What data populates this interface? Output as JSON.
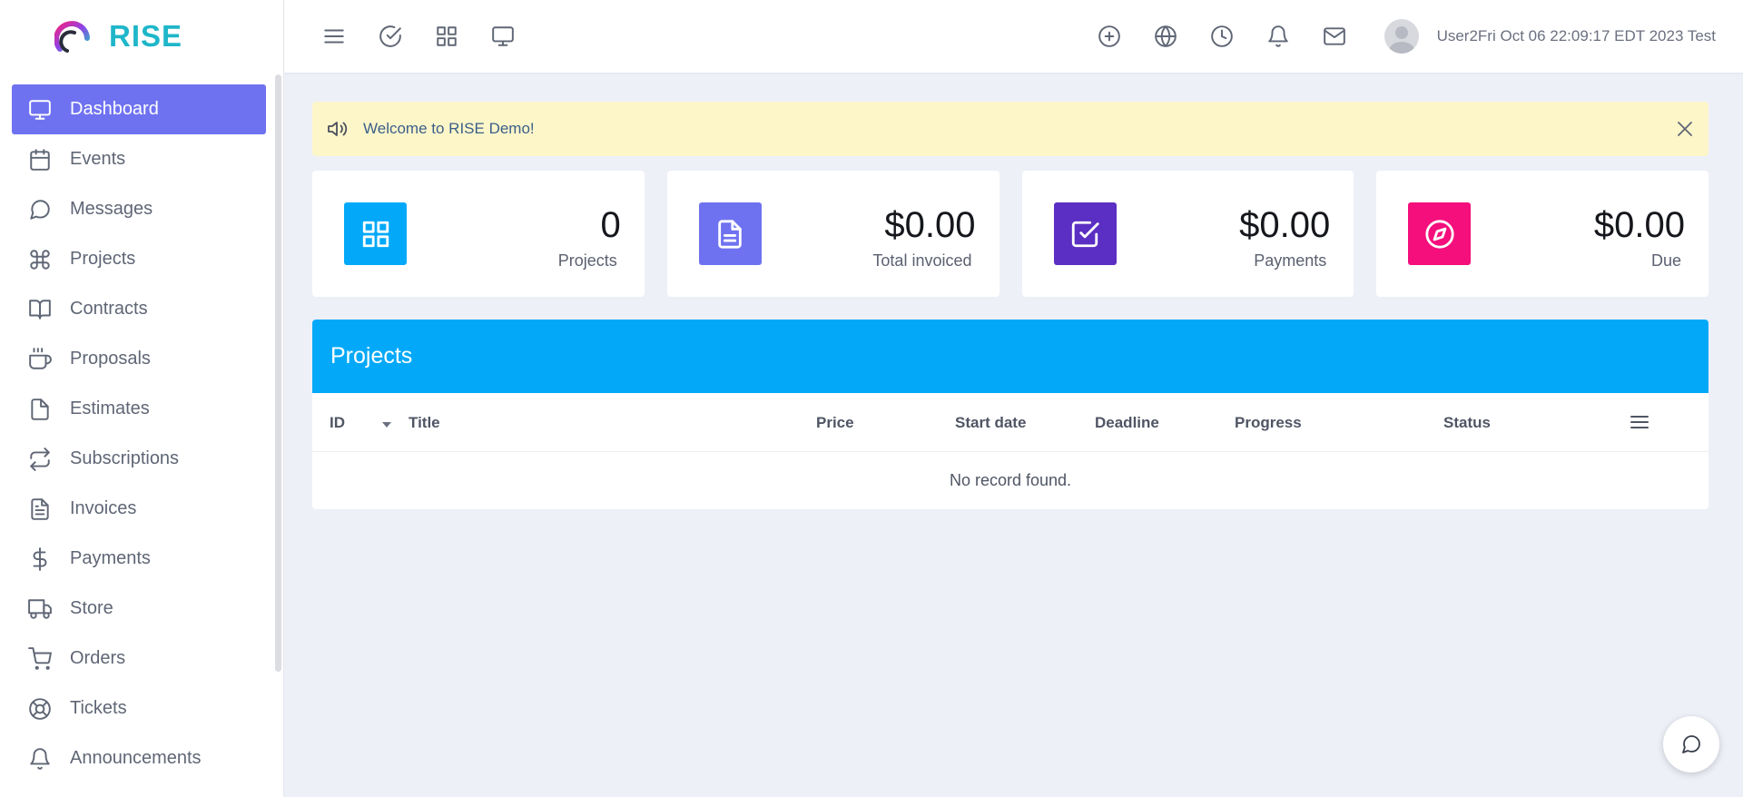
{
  "brand": {
    "name": "RISE"
  },
  "sidebar": {
    "items": [
      {
        "label": "Dashboard",
        "icon": "monitor-icon",
        "active": true
      },
      {
        "label": "Events",
        "icon": "calendar-icon"
      },
      {
        "label": "Messages",
        "icon": "message-circle-icon"
      },
      {
        "label": "Projects",
        "icon": "command-icon"
      },
      {
        "label": "Contracts",
        "icon": "book-open-icon"
      },
      {
        "label": "Proposals",
        "icon": "coffee-icon"
      },
      {
        "label": "Estimates",
        "icon": "file-icon"
      },
      {
        "label": "Subscriptions",
        "icon": "repeat-icon"
      },
      {
        "label": "Invoices",
        "icon": "file-text-icon"
      },
      {
        "label": "Payments",
        "icon": "dollar-sign-icon"
      },
      {
        "label": "Store",
        "icon": "truck-icon"
      },
      {
        "label": "Orders",
        "icon": "shopping-cart-icon"
      },
      {
        "label": "Tickets",
        "icon": "life-buoy-icon"
      },
      {
        "label": "Announcements",
        "icon": "bell-icon"
      }
    ]
  },
  "topbar": {
    "left_icons": [
      "menu-icon",
      "check-circle-icon",
      "grid-icon",
      "monitor-icon"
    ],
    "right_icons": [
      "plus-circle-icon",
      "globe-icon",
      "clock-icon",
      "bell-icon",
      "mail-icon"
    ],
    "user_name": "User2Fri Oct 06 22:09:17 EDT 2023 Test"
  },
  "alert": {
    "text": "Welcome to RISE Demo!"
  },
  "cards": [
    {
      "value": "0",
      "label": "Projects",
      "icon": "grid-icon",
      "color": "#03a9f8"
    },
    {
      "value": "$0.00",
      "label": "Total invoiced",
      "icon": "file-text-icon",
      "color": "#6f72f0"
    },
    {
      "value": "$0.00",
      "label": "Payments",
      "icon": "check-square-icon",
      "color": "#5b2fc3"
    },
    {
      "value": "$0.00",
      "label": "Due",
      "icon": "compass-icon",
      "color": "#f40f7c"
    }
  ],
  "projects_panel": {
    "title": "Projects",
    "columns": [
      "ID",
      "Title",
      "Price",
      "Start date",
      "Deadline",
      "Progress",
      "Status"
    ],
    "empty_text": "No record found."
  },
  "colors": {
    "accent": "#6f72f0",
    "panel_header": "#03a9f8",
    "alert_bg": "#fdf6c9",
    "page_bg": "#eef0f8"
  }
}
